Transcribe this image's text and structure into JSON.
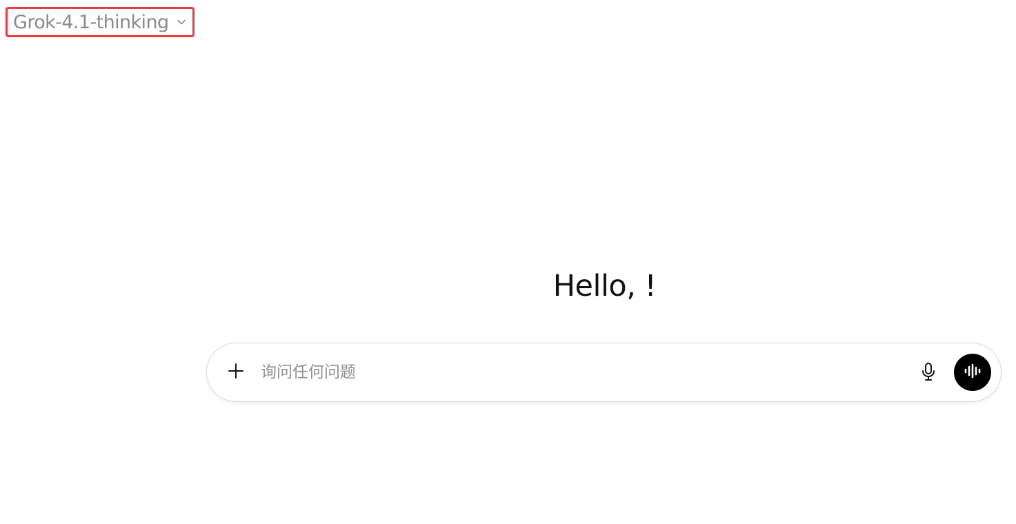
{
  "model_selector": {
    "label": "Grok-4.1-thinking",
    "icon": "chevron-down-icon"
  },
  "greeting": {
    "text": "Hello, !"
  },
  "composer": {
    "placeholder": "询问任何问题",
    "value": "",
    "add_icon": "plus-icon",
    "mic_icon": "microphone-icon",
    "voice_icon": "voice-waveform-icon"
  },
  "colors": {
    "highlight_border": "#ee3b43",
    "model_text": "#8a8a8a",
    "voice_button_bg": "#000000",
    "composer_border": "#d9d9d9"
  }
}
